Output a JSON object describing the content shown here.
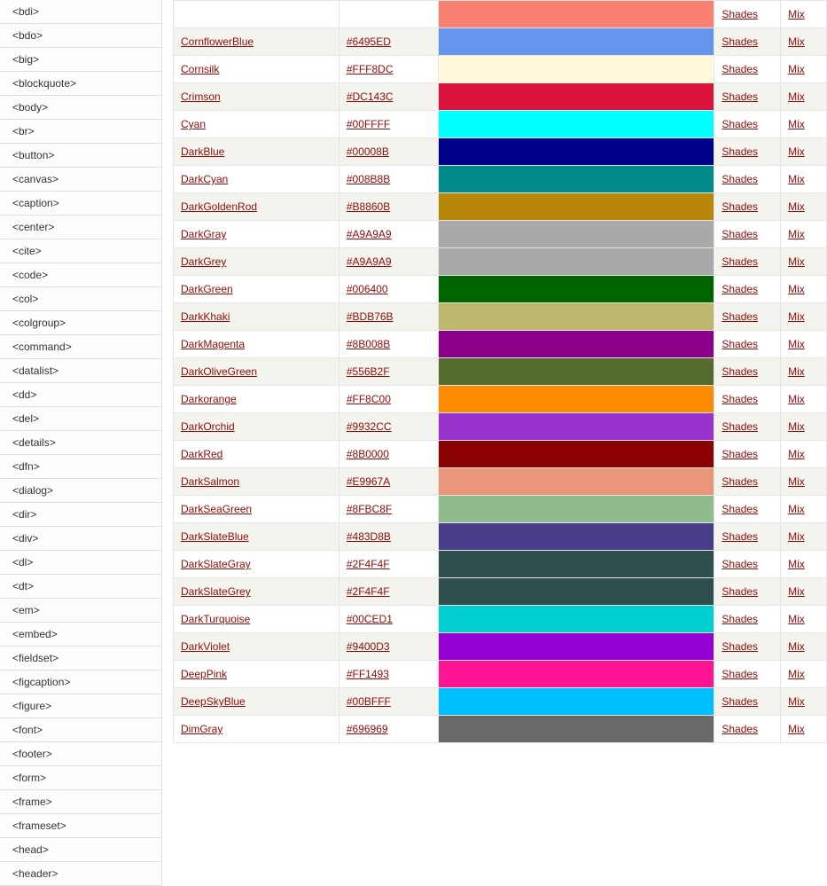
{
  "sidebar": {
    "items": [
      "<bdi>",
      "<bdo>",
      "<big>",
      "<blockquote>",
      "<body>",
      "<br>",
      "<button>",
      "<canvas>",
      "<caption>",
      "<center>",
      "<cite>",
      "<code>",
      "<col>",
      "<colgroup>",
      "<command>",
      "<datalist>",
      "<dd>",
      "<del>",
      "<details>",
      "<dfn>",
      "<dialog>",
      "<dir>",
      "<div>",
      "<dl>",
      "<dt>",
      "<em>",
      "<embed>",
      "<fieldset>",
      "<figcaption>",
      "<figure>",
      "<font>",
      "<footer>",
      "<form>",
      "<frame>",
      "<frameset>",
      "<head>",
      "<header>"
    ]
  },
  "labels": {
    "shades": "Shades",
    "mix": "Mix"
  },
  "colors": [
    {
      "name": "",
      "hex": "",
      "swatch": "#FA8072",
      "alt": false
    },
    {
      "name": "CornflowerBlue",
      "hex": "#6495ED",
      "swatch": "#6495ED",
      "alt": true
    },
    {
      "name": "Cornsilk",
      "hex": "#FFF8DC",
      "swatch": "#FFF8DC",
      "alt": false
    },
    {
      "name": "Crimson",
      "hex": "#DC143C",
      "swatch": "#DC143C",
      "alt": true
    },
    {
      "name": "Cyan",
      "hex": "#00FFFF",
      "swatch": "#00FFFF",
      "alt": false
    },
    {
      "name": "DarkBlue",
      "hex": "#00008B",
      "swatch": "#00008B",
      "alt": true
    },
    {
      "name": "DarkCyan",
      "hex": "#008B8B",
      "swatch": "#008B8B",
      "alt": false
    },
    {
      "name": "DarkGoldenRod",
      "hex": "#B8860B",
      "swatch": "#B8860B",
      "alt": true
    },
    {
      "name": "DarkGray",
      "hex": "#A9A9A9",
      "swatch": "#A9A9A9",
      "alt": false
    },
    {
      "name": "DarkGrey",
      "hex": "#A9A9A9",
      "swatch": "#A9A9A9",
      "alt": true
    },
    {
      "name": "DarkGreen",
      "hex": "#006400",
      "swatch": "#006400",
      "alt": false
    },
    {
      "name": "DarkKhaki",
      "hex": "#BDB76B",
      "swatch": "#BDB76B",
      "alt": true
    },
    {
      "name": "DarkMagenta",
      "hex": "#8B008B",
      "swatch": "#8B008B",
      "alt": false
    },
    {
      "name": "DarkOliveGreen",
      "hex": "#556B2F",
      "swatch": "#556B2F",
      "alt": true
    },
    {
      "name": "Darkorange",
      "hex": "#FF8C00",
      "swatch": "#FF8C00",
      "alt": false
    },
    {
      "name": "DarkOrchid",
      "hex": "#9932CC",
      "swatch": "#9932CC",
      "alt": true
    },
    {
      "name": "DarkRed",
      "hex": "#8B0000",
      "swatch": "#8B0000",
      "alt": false
    },
    {
      "name": "DarkSalmon",
      "hex": "#E9967A",
      "swatch": "#E9967A",
      "alt": true
    },
    {
      "name": "DarkSeaGreen",
      "hex": "#8FBC8F",
      "swatch": "#8FBC8F",
      "alt": false
    },
    {
      "name": "DarkSlateBlue",
      "hex": "#483D8B",
      "swatch": "#483D8B",
      "alt": true
    },
    {
      "name": "DarkSlateGray",
      "hex": "#2F4F4F",
      "swatch": "#2F4F4F",
      "alt": false
    },
    {
      "name": "DarkSlateGrey",
      "hex": "#2F4F4F",
      "swatch": "#2F4F4F",
      "alt": true
    },
    {
      "name": "DarkTurquoise",
      "hex": "#00CED1",
      "swatch": "#00CED1",
      "alt": false
    },
    {
      "name": "DarkViolet",
      "hex": "#9400D3",
      "swatch": "#9400D3",
      "alt": true
    },
    {
      "name": "DeepPink",
      "hex": "#FF1493",
      "swatch": "#FF1493",
      "alt": false
    },
    {
      "name": "DeepSkyBlue",
      "hex": "#00BFFF",
      "swatch": "#00BFFF",
      "alt": true
    },
    {
      "name": "DimGray",
      "hex": "#696969",
      "swatch": "#696969",
      "alt": false
    }
  ]
}
